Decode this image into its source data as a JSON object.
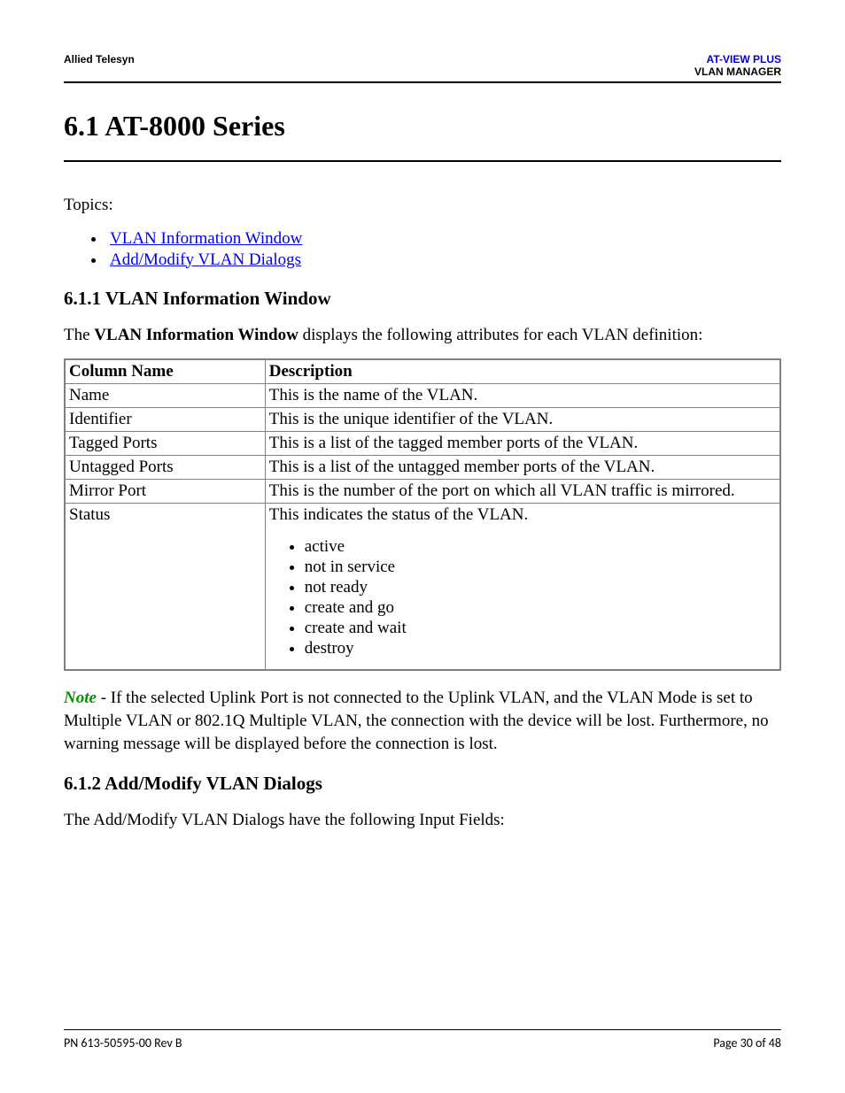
{
  "header": {
    "left": "Allied Telesyn",
    "right_line1": "AT-VIEW PLUS",
    "right_line2": "VLAN MANAGER"
  },
  "section": {
    "number_title": "6.1 AT-8000 Series",
    "topics_label": "Topics:",
    "topic_links": [
      "VLAN Information Window",
      "Add/Modify VLAN Dialogs"
    ]
  },
  "sub1": {
    "heading": "6.1.1 VLAN Information Window",
    "intro_pre": "The ",
    "intro_bold": "VLAN Information Window",
    "intro_post": " displays the following attributes for each VLAN definition:",
    "table_headers": [
      "Column Name",
      "Description"
    ],
    "rows": [
      {
        "col": "Name",
        "desc": "This is the name of the VLAN."
      },
      {
        "col": "Identifier",
        "desc": "This is the unique identifier of the VLAN."
      },
      {
        "col": "Tagged Ports",
        "desc": "This is a list of the tagged member ports of the VLAN."
      },
      {
        "col": "Untagged Ports",
        "desc": "This is a list of the untagged member ports of the VLAN."
      },
      {
        "col": "Mirror Port",
        "desc": "This is the number of the port on which all VLAN traffic is mirrored."
      }
    ],
    "status_row": {
      "col": "Status",
      "desc_intro": "This indicates the status of the VLAN.",
      "items": [
        "active",
        "not in service",
        "not ready",
        "create and go",
        "create and wait",
        "destroy"
      ]
    },
    "note_label": "Note",
    "note_body": " - If the selected Uplink Port is not connected to the Uplink VLAN, and the VLAN Mode is set to Multiple VLAN or 802.1Q Multiple VLAN, the connection with the device will be lost. Furthermore, no warning message will be displayed before the connection is lost."
  },
  "sub2": {
    "heading": "6.1.2 Add/Modify VLAN Dialogs",
    "intro": "The Add/Modify VLAN Dialogs have the following Input Fields:"
  },
  "footer": {
    "left": "PN 613-50595-00 Rev B",
    "right": "Page 30 of 48"
  }
}
